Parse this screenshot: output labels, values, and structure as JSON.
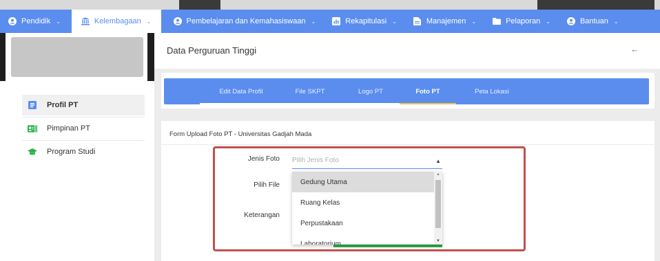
{
  "nav": {
    "items": [
      {
        "label": "Pendidik",
        "icon": "user-circle-icon"
      },
      {
        "label": "Kelembagaan",
        "icon": "institution-icon"
      },
      {
        "label": "Pembelajaran dan Kemahasiswaan",
        "icon": "user-circle-icon"
      },
      {
        "label": "Rekapitulasi",
        "icon": "chart-icon"
      },
      {
        "label": "Manajemen",
        "icon": "document-icon"
      },
      {
        "label": "Pelaporan",
        "icon": "folder-icon"
      },
      {
        "label": "Bantuan",
        "icon": "user-circle-icon"
      }
    ],
    "active_index": 1
  },
  "sidebar": {
    "items": [
      {
        "label": "Profil PT",
        "icon": "id-card-icon",
        "active": true
      },
      {
        "label": "Pimpinan PT",
        "icon": "contact-card-icon",
        "active": false
      },
      {
        "label": "Program Studi",
        "icon": "graduation-cap-icon",
        "active": false
      }
    ]
  },
  "page": {
    "title": "Data Perguruan Tinggi",
    "back_icon": "arrow-left-icon"
  },
  "tabs": {
    "items": [
      "Edit Data Profil",
      "File SKPT",
      "Logo PT",
      "Foto PT",
      "Peta Lokasi"
    ],
    "active_index": 3
  },
  "form": {
    "title": "Form Upload Foto PT - Universitas Gadjah Mada",
    "jenis_foto_label": "Jenis Foto",
    "jenis_foto_placeholder": "Pilih Jenis Foto",
    "pilih_file_label": "Pilih File",
    "keterangan_label": "Keterangan",
    "dropdown_options": [
      "Gedung Utama",
      "Ruang Kelas",
      "Perpustakaan",
      "Laboratorium"
    ],
    "hovered_option_index": 0
  },
  "colors": {
    "primary": "#5b8def",
    "tab_active_underline": "#f4c542",
    "highlight_border": "#c0504d",
    "button_green": "#2bb24c"
  }
}
